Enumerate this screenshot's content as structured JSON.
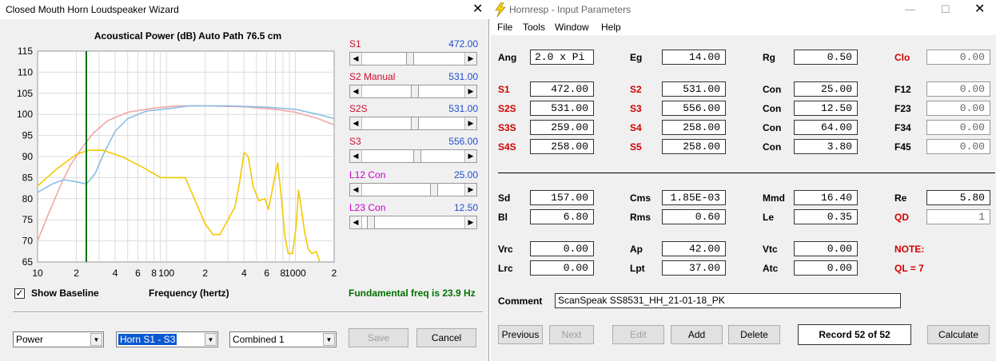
{
  "wizard": {
    "title": "Closed Mouth Horn Loudspeaker Wizard",
    "chart_title": "Acoustical Power (dB)   Auto Path 76.5 cm",
    "show_baseline_label": "Show Baseline",
    "show_baseline_checked": true,
    "frequency_label": "Frequency (hertz)",
    "fundamental": "Fundamental freq is 23.9 Hz",
    "sliders": [
      {
        "label": "S1",
        "value": "472.00",
        "color": "red",
        "position": 0.47
      },
      {
        "label": "S2 Manual",
        "value": "531.00",
        "color": "red",
        "position": 0.52
      },
      {
        "label": "S2S",
        "value": "531.00",
        "color": "red",
        "position": 0.52
      },
      {
        "label": "S3",
        "value": "556.00",
        "color": "red",
        "position": 0.54
      },
      {
        "label": "L12 Con",
        "value": "25.00",
        "color": "magenta",
        "position": 0.72
      },
      {
        "label": "L23 Con",
        "value": "12.50",
        "color": "magenta",
        "position": 0.05
      }
    ],
    "combos": {
      "power": "Power",
      "horn": "Horn S1 - S3",
      "combined": "Combined 1"
    },
    "save_label": "Save",
    "cancel_label": "Cancel"
  },
  "chart_data": {
    "type": "line",
    "title": "Acoustical Power (dB)   Auto Path 76.5 cm",
    "xlabel": "Frequency (hertz)",
    "ylabel": "",
    "x_scale": "log",
    "xlim": [
      10,
      2000
    ],
    "ylim": [
      65,
      115
    ],
    "y_ticks": [
      65,
      70,
      75,
      80,
      85,
      90,
      95,
      100,
      105,
      110,
      115
    ],
    "x_tick_labels": [
      {
        "x": 10,
        "label": "10"
      },
      {
        "x": 20,
        "label": "2"
      },
      {
        "x": 40,
        "label": "4"
      },
      {
        "x": 60,
        "label": "6"
      },
      {
        "x": 80,
        "label": "8"
      },
      {
        "x": 100,
        "label": "100"
      },
      {
        "x": 200,
        "label": "2"
      },
      {
        "x": 400,
        "label": "4"
      },
      {
        "x": 600,
        "label": "6"
      },
      {
        "x": 800,
        "label": "8"
      },
      {
        "x": 1000,
        "label": "1000"
      },
      {
        "x": 2000,
        "label": "2"
      }
    ],
    "grid": true,
    "marker_x": 23.9,
    "colors": {
      "pink": "#f2a7a7",
      "blue": "#8cbce6",
      "yellow": "#f5c800",
      "marker": "#007000"
    },
    "series": [
      {
        "color": "pink",
        "points": [
          [
            10,
            70
          ],
          [
            12,
            76
          ],
          [
            15,
            83
          ],
          [
            18,
            88
          ],
          [
            22,
            92
          ],
          [
            27,
            95.5
          ],
          [
            35,
            98.5
          ],
          [
            50,
            100.5
          ],
          [
            80,
            101.5
          ],
          [
            120,
            102
          ],
          [
            200,
            102
          ],
          [
            400,
            101.8
          ],
          [
            700,
            101.2
          ],
          [
            1000,
            100.5
          ],
          [
            1500,
            99
          ],
          [
            2000,
            97.5
          ]
        ]
      },
      {
        "color": "blue",
        "points": [
          [
            10,
            81.5
          ],
          [
            13,
            83.5
          ],
          [
            16,
            84.5
          ],
          [
            20,
            84
          ],
          [
            24,
            83.5
          ],
          [
            28,
            86
          ],
          [
            33,
            91
          ],
          [
            40,
            96
          ],
          [
            50,
            99
          ],
          [
            70,
            100.8
          ],
          [
            100,
            101.3
          ],
          [
            150,
            102
          ],
          [
            300,
            102
          ],
          [
            600,
            101.7
          ],
          [
            1000,
            101.2
          ],
          [
            1500,
            100
          ],
          [
            2000,
            99
          ]
        ]
      },
      {
        "color": "yellow",
        "points": [
          [
            10,
            83
          ],
          [
            14,
            87
          ],
          [
            20,
            90.5
          ],
          [
            25,
            91.5
          ],
          [
            32,
            91.5
          ],
          [
            45,
            90
          ],
          [
            65,
            87.5
          ],
          [
            90,
            85
          ],
          [
            110,
            85
          ],
          [
            140,
            85
          ],
          [
            170,
            79
          ],
          [
            200,
            74
          ],
          [
            230,
            71.5
          ],
          [
            260,
            71.5
          ],
          [
            300,
            75
          ],
          [
            340,
            78
          ],
          [
            370,
            84
          ],
          [
            400,
            91
          ],
          [
            430,
            90
          ],
          [
            470,
            83
          ],
          [
            520,
            79.5
          ],
          [
            580,
            80
          ],
          [
            620,
            77.5
          ],
          [
            680,
            84
          ],
          [
            730,
            88.5
          ],
          [
            780,
            80
          ],
          [
            830,
            71
          ],
          [
            880,
            67
          ],
          [
            950,
            67
          ],
          [
            1010,
            73
          ],
          [
            1060,
            82
          ],
          [
            1110,
            78
          ],
          [
            1180,
            72
          ],
          [
            1260,
            68
          ],
          [
            1350,
            67
          ],
          [
            1450,
            67.5
          ],
          [
            1550,
            64
          ]
        ]
      }
    ]
  },
  "hornresp": {
    "title": "Hornresp - Input Parameters",
    "menu": [
      "File",
      "Tools",
      "Window",
      "Help"
    ],
    "top_params": [
      {
        "label": "Ang",
        "value": "2.0 x Pi",
        "red": false,
        "left": true
      },
      {
        "label": "Eg",
        "value": "14.00",
        "red": false
      },
      {
        "label": "Rg",
        "value": "0.50",
        "red": false
      },
      {
        "label": "Clo",
        "value": "0.00",
        "red": true,
        "dim": true
      }
    ],
    "horn_rows": [
      [
        {
          "label": "S1",
          "value": "472.00",
          "red": true
        },
        {
          "label": "S2",
          "value": "531.00",
          "red": true
        },
        {
          "label": "Con",
          "value": "25.00",
          "red": false
        },
        {
          "label": "F12",
          "value": "0.00",
          "red": false,
          "dim": true
        }
      ],
      [
        {
          "label": "S2S",
          "value": "531.00",
          "red": true
        },
        {
          "label": "S3",
          "value": "556.00",
          "red": true
        },
        {
          "label": "Con",
          "value": "12.50",
          "red": false
        },
        {
          "label": "F23",
          "value": "0.00",
          "red": false,
          "dim": true
        }
      ],
      [
        {
          "label": "S3S",
          "value": "259.00",
          "red": true
        },
        {
          "label": "S4",
          "value": "258.00",
          "red": true
        },
        {
          "label": "Con",
          "value": "64.00",
          "red": false
        },
        {
          "label": "F34",
          "value": "0.00",
          "red": false,
          "dim": true
        }
      ],
      [
        {
          "label": "S4S",
          "value": "258.00",
          "red": true
        },
        {
          "label": "S5",
          "value": "258.00",
          "red": true
        },
        {
          "label": "Con",
          "value": "3.80",
          "red": false
        },
        {
          "label": "F45",
          "value": "0.00",
          "red": false,
          "dim": true
        }
      ]
    ],
    "driver_rows": [
      [
        {
          "label": "Sd",
          "value": "157.00",
          "red": false
        },
        {
          "label": "Cms",
          "value": "1.85E-03",
          "red": false
        },
        {
          "label": "Mmd",
          "value": "16.40",
          "red": false
        },
        {
          "label": "Re",
          "value": "5.80",
          "red": false
        }
      ],
      [
        {
          "label": "Bl",
          "value": "6.80",
          "red": false
        },
        {
          "label": "Rms",
          "value": "0.60",
          "red": false
        },
        {
          "label": "Le",
          "value": "0.35",
          "red": false
        },
        {
          "label": "QD",
          "value": "1",
          "red": true,
          "dim": true
        }
      ]
    ],
    "chamber_rows": [
      [
        {
          "label": "Vrc",
          "value": "0.00"
        },
        {
          "label": "Ap",
          "value": "42.00"
        },
        {
          "label": "Vtc",
          "value": "0.00"
        }
      ],
      [
        {
          "label": "Lrc",
          "value": "0.00"
        },
        {
          "label": "Lpt",
          "value": "37.00"
        },
        {
          "label": "Atc",
          "value": "0.00"
        }
      ]
    ],
    "note_label": "NOTE:",
    "note_text": "QL = 7",
    "comment_label": "Comment",
    "comment_value": "ScanSpeak SS8531_HH_21-01-18_PK",
    "buttons": {
      "previous": "Previous",
      "next": "Next",
      "edit": "Edit",
      "add": "Add",
      "delete": "Delete",
      "calculate": "Calculate"
    },
    "record": "Record 52 of 52"
  }
}
